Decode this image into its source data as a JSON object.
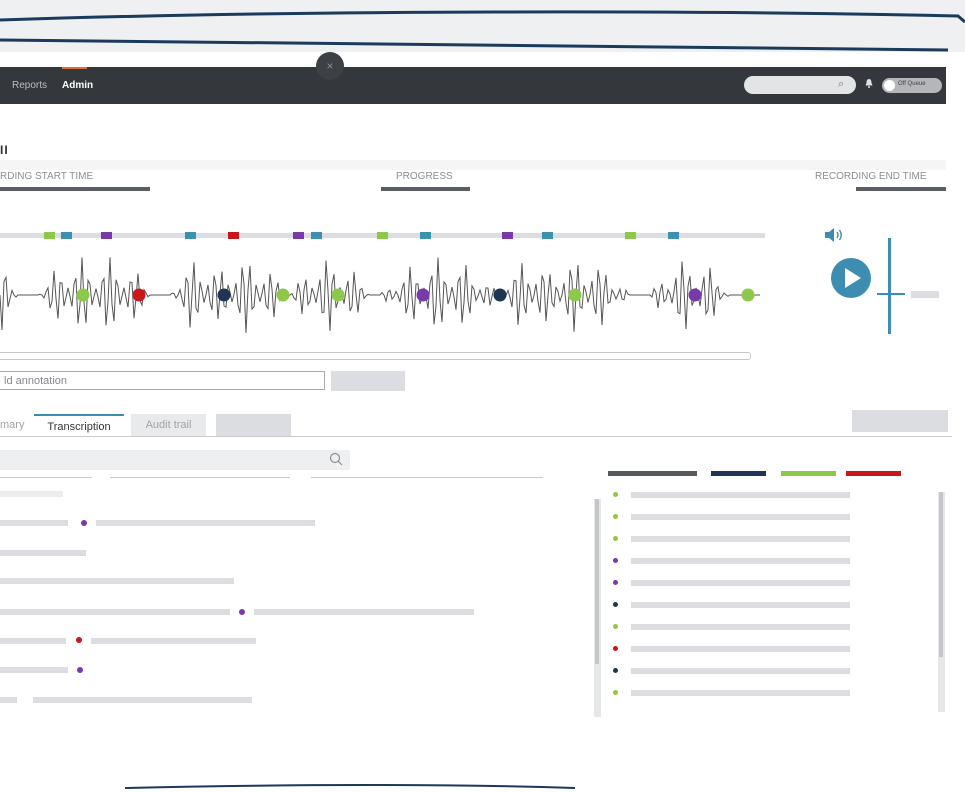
{
  "nav": {
    "items": [
      {
        "label": "Reports",
        "active": false
      },
      {
        "label": "Admin",
        "active": true
      }
    ],
    "close_glyph": "×",
    "queue_toggle_label": "Off Queue",
    "search_icon": "⌕",
    "icons": [
      "search-icon",
      "bell-icon",
      "close-icon"
    ]
  },
  "call": {
    "title_mark": "II",
    "start_label": "RDING START TIME",
    "progress_label": "PROGRESS",
    "end_label": "RECORDING END TIME"
  },
  "colors": {
    "green": "#8dc84a",
    "teal": "#3c92ae",
    "purple": "#7a38a8",
    "red": "#c8161d",
    "navy": "#203454",
    "accent": "#3c8db0",
    "topbar": "#34373b",
    "orange": "#e0703a"
  },
  "annotation_tags": [
    "green",
    "teal",
    "purple",
    "teal",
    "red",
    "purple",
    "teal",
    "green",
    "teal",
    "purple",
    "teal",
    "green",
    "teal"
  ],
  "waveform_markers": [
    "green",
    "red",
    "navy",
    "green",
    "green",
    "purple",
    "navy",
    "green",
    "purple",
    "green"
  ],
  "player": {
    "icons": [
      "speaker-icon",
      "play-icon"
    ]
  },
  "annotation": {
    "input_value": "ld annotation"
  },
  "tabs": [
    {
      "label": "mary",
      "selected": false
    },
    {
      "label": "Transcription",
      "selected": true
    },
    {
      "label": "Audit trail",
      "selected": false
    }
  ],
  "transcript_markers": [
    "purple",
    "purple",
    "red",
    "purple"
  ],
  "legend": {
    "swatches": [
      "#555a5e",
      "#203454",
      "#8dc84a",
      "#c8161d"
    ],
    "item_dots": [
      "green",
      "green",
      "green",
      "purple",
      "purple",
      "navy",
      "green",
      "red",
      "navy",
      "green"
    ]
  }
}
